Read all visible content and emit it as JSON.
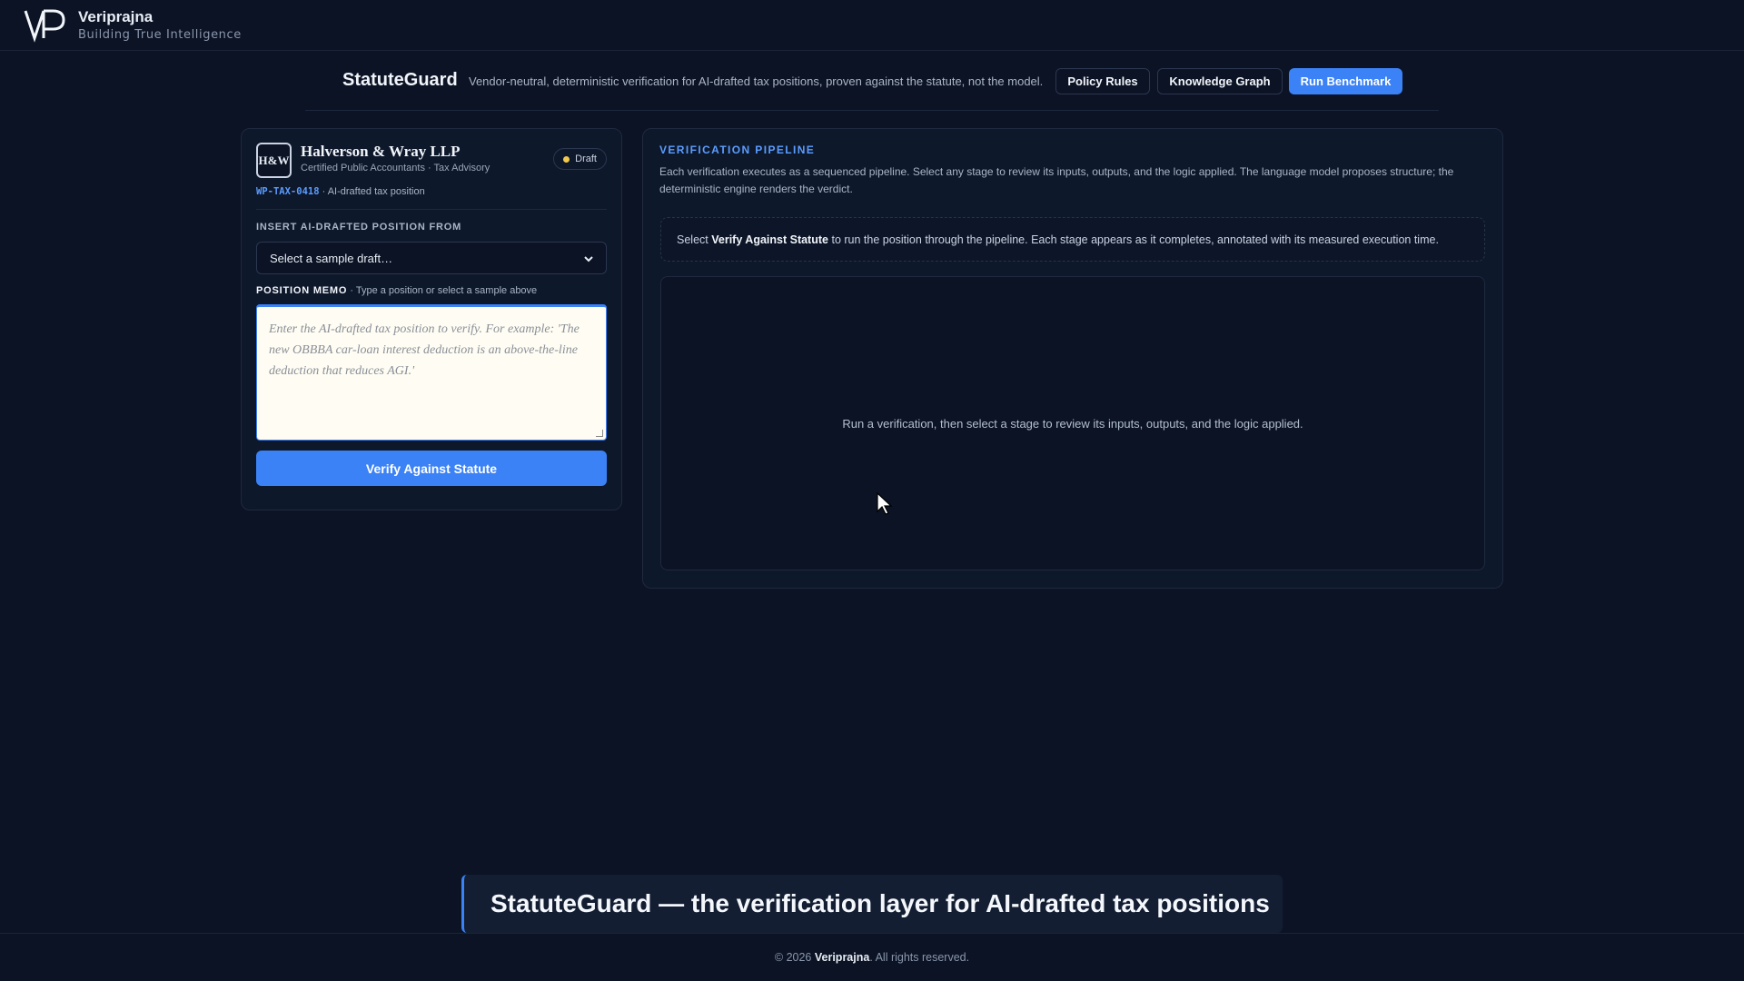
{
  "brand": {
    "name": "Veriprajna",
    "tagline": "Building True Intelligence"
  },
  "header": {
    "app_title": "StatuteGuard",
    "subtitle": "Vendor-neutral, deterministic verification for AI-drafted tax positions, proven against the statute, not the model.",
    "buttons": {
      "policy_rules": "Policy Rules",
      "knowledge_graph": "Knowledge Graph",
      "run_benchmark": "Run Benchmark"
    }
  },
  "firm": {
    "logo_text": "H&W",
    "name": "Halverson & Wray LLP",
    "description": "Certified Public Accountants · Tax Advisory",
    "status_badge": "Draft",
    "doc_id": "WP-TAX-0418",
    "doc_type": "· AI-drafted tax position"
  },
  "insert": {
    "label": "INSERT AI-DRAFTED POSITION FROM",
    "select_value": "Select a sample draft…"
  },
  "memo": {
    "label": "POSITION MEMO",
    "hint": "· Type a position or select a sample above",
    "placeholder": "Enter the AI-drafted tax position to verify. For example: 'The new OBBBA car-loan interest deduction is an above-the-line deduction that reduces AGI.'",
    "value": ""
  },
  "verify_button": "Verify Against Statute",
  "pipeline": {
    "title": "VERIFICATION PIPELINE",
    "description": "Each verification executes as a sequenced pipeline. Select any stage to review its inputs, outputs, and the logic applied. The language model proposes structure; the deterministic engine renders the verdict.",
    "info_prefix": "Select",
    "info_bold": "Verify Against Statute",
    "info_suffix": "to run the position through the pipeline. Each stage appears as it completes, annotated with its measured execution time.",
    "empty_state": "Run a verification, then select a stage to review its inputs, outputs, and the logic applied."
  },
  "caption": "StatuteGuard — the verification layer for AI-drafted tax positions",
  "footer": {
    "prefix": "© 2026",
    "brand": "Veriprajna",
    "suffix": ". All rights reserved."
  },
  "colors": {
    "background": "#0b1324",
    "panel": "#0e182b",
    "accent": "#3b82f6",
    "draft_dot": "#f2c94c"
  }
}
